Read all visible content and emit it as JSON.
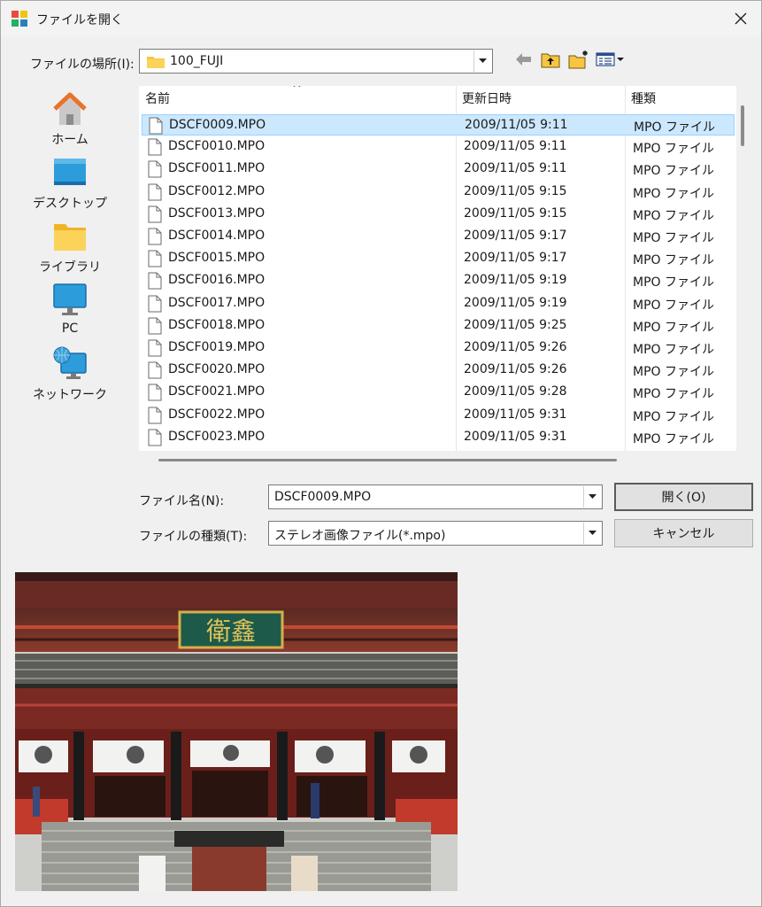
{
  "title": "ファイルを開く",
  "look_in": {
    "label": "ファイルの場所(I):",
    "value": "100_FUJI"
  },
  "toolbar": {
    "back_icon": "back-arrow-icon",
    "up_icon": "up-folder-icon",
    "new_folder_icon": "new-folder-icon",
    "view_icon": "view-menu-icon"
  },
  "places": [
    {
      "id": "home",
      "label": "ホーム",
      "icon": "home-icon"
    },
    {
      "id": "desktop",
      "label": "デスクトップ",
      "icon": "desktop-icon"
    },
    {
      "id": "library",
      "label": "ライブラリ",
      "icon": "library-folder-icon"
    },
    {
      "id": "pc",
      "label": "PC",
      "icon": "pc-monitor-icon"
    },
    {
      "id": "network",
      "label": "ネットワーク",
      "icon": "network-icon"
    }
  ],
  "columns": {
    "name": "名前",
    "date": "更新日時",
    "type": "種類"
  },
  "files": [
    {
      "name": "DSCF0009.MPO",
      "date": "2009/11/05 9:11",
      "type": "MPO ファイル",
      "selected": true
    },
    {
      "name": "DSCF0010.MPO",
      "date": "2009/11/05 9:11",
      "type": "MPO ファイル"
    },
    {
      "name": "DSCF0011.MPO",
      "date": "2009/11/05 9:11",
      "type": "MPO ファイル"
    },
    {
      "name": "DSCF0012.MPO",
      "date": "2009/11/05 9:15",
      "type": "MPO ファイル"
    },
    {
      "name": "DSCF0013.MPO",
      "date": "2009/11/05 9:15",
      "type": "MPO ファイル"
    },
    {
      "name": "DSCF0014.MPO",
      "date": "2009/11/05 9:17",
      "type": "MPO ファイル"
    },
    {
      "name": "DSCF0015.MPO",
      "date": "2009/11/05 9:17",
      "type": "MPO ファイル"
    },
    {
      "name": "DSCF0016.MPO",
      "date": "2009/11/05 9:19",
      "type": "MPO ファイル"
    },
    {
      "name": "DSCF0017.MPO",
      "date": "2009/11/05 9:19",
      "type": "MPO ファイル"
    },
    {
      "name": "DSCF0018.MPO",
      "date": "2009/11/05 9:25",
      "type": "MPO ファイル"
    },
    {
      "name": "DSCF0019.MPO",
      "date": "2009/11/05 9:26",
      "type": "MPO ファイル"
    },
    {
      "name": "DSCF0020.MPO",
      "date": "2009/11/05 9:26",
      "type": "MPO ファイル"
    },
    {
      "name": "DSCF0021.MPO",
      "date": "2009/11/05 9:28",
      "type": "MPO ファイル"
    },
    {
      "name": "DSCF0022.MPO",
      "date": "2009/11/05 9:31",
      "type": "MPO ファイル"
    },
    {
      "name": "DSCF0023.MPO",
      "date": "2009/11/05 9:31",
      "type": "MPO ファイル"
    }
  ],
  "filename": {
    "label": "ファイル名(N):",
    "value": "DSCF0009.MPO"
  },
  "filetype": {
    "label": "ファイルの種類(T):",
    "value": "ステレオ画像ファイル(*.mpo)"
  },
  "buttons": {
    "open": "開く(O)",
    "cancel": "キャンセル"
  },
  "preview": {
    "sign_text": "衛鑫"
  },
  "colors": {
    "selection": "#cce8ff",
    "selection_border": "#99d1ff",
    "folder": "#f8c542",
    "accent": "#2d9cdb"
  }
}
